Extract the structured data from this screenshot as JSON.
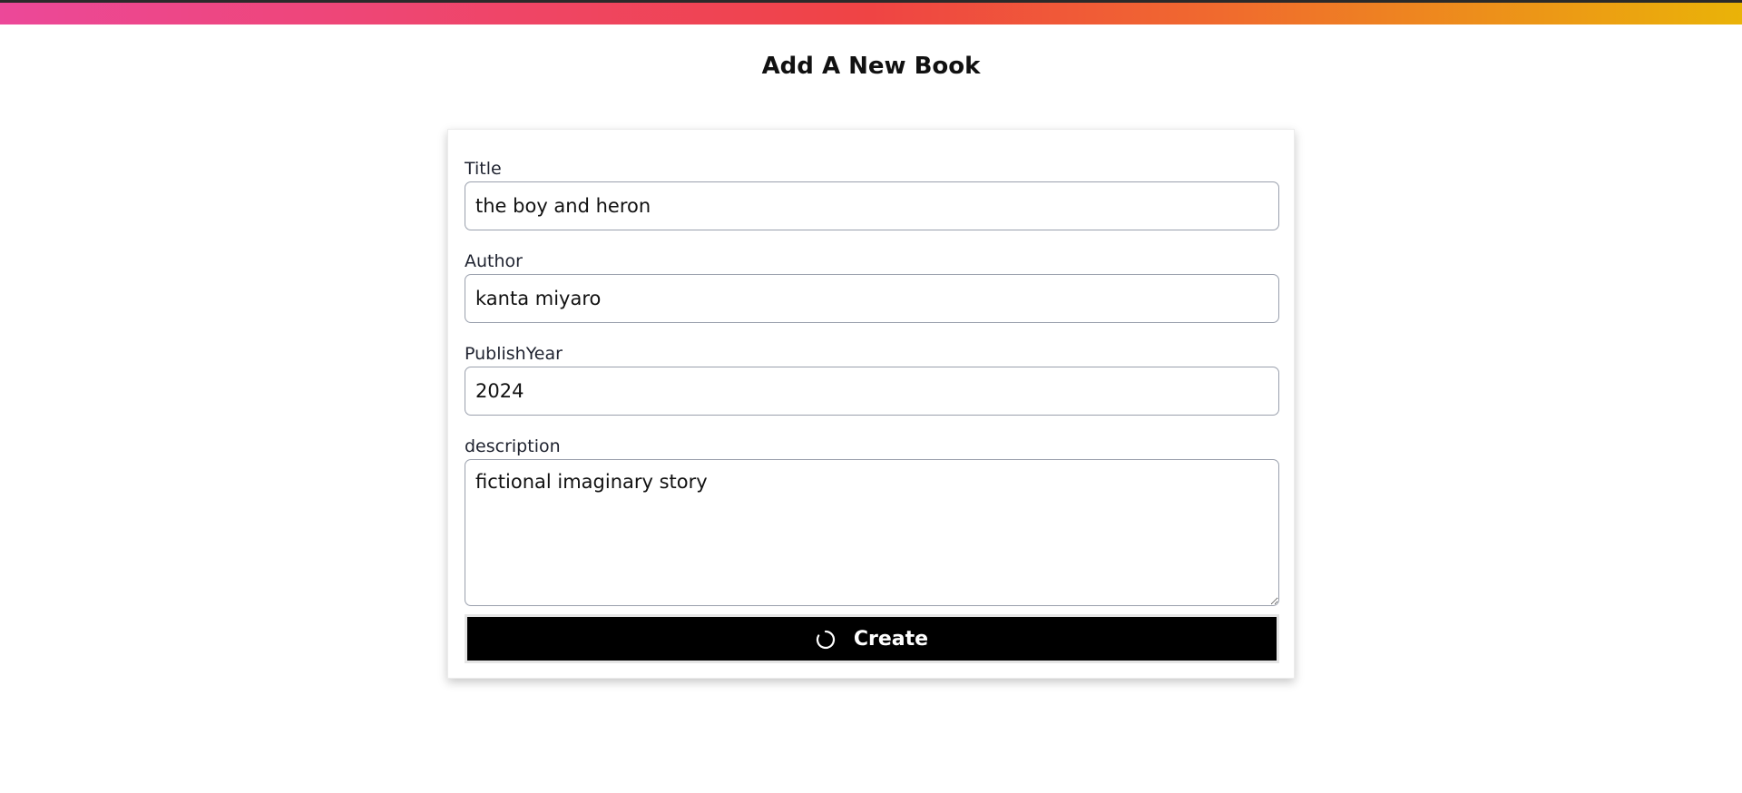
{
  "header": {
    "title": "Add A New Book"
  },
  "form": {
    "title_label": "Title",
    "title_value": "the boy and heron",
    "author_label": "Author",
    "author_value": "kanta miyaro",
    "publish_year_label": "PublishYear",
    "publish_year_value": "2024",
    "description_label": "description",
    "description_value": "fictional imaginary story",
    "submit_label": "Create",
    "submit_icon": "spinner-icon"
  },
  "colors": {
    "gradient_start": "#ec4899",
    "gradient_mid": "#ef4444",
    "gradient_end": "#eab308",
    "button_bg": "#000000",
    "button_text": "#ffffff"
  }
}
